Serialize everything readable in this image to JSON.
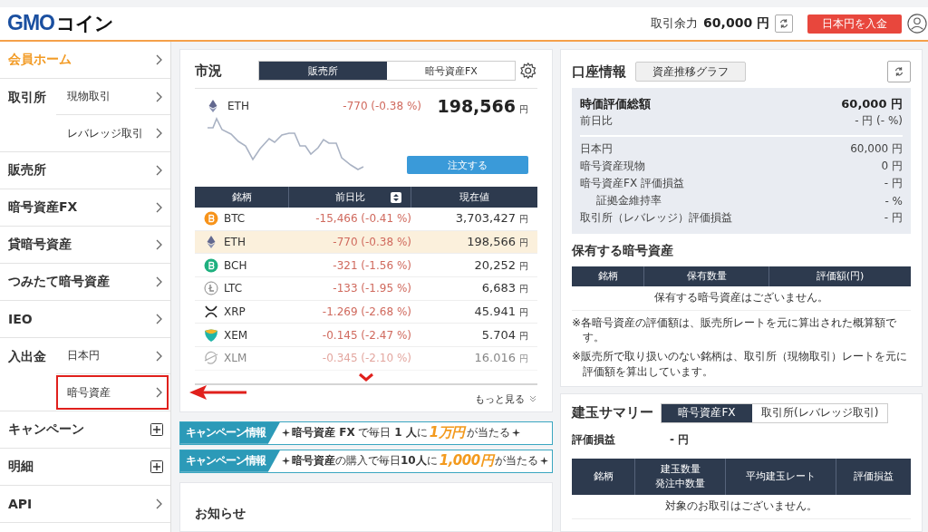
{
  "header": {
    "logo": {
      "brand": "GMO",
      "name": "コイン"
    },
    "balance_label": "取引余力",
    "balance_value": "60,000 円",
    "deposit_button": "日本円を入金"
  },
  "sidebar": {
    "items": [
      {
        "label": "会員ホーム",
        "kind": "link",
        "selected": true
      },
      {
        "label": "取引所",
        "kind": "group",
        "children": [
          {
            "label": "現物取引",
            "selected": false,
            "highlighted": false
          },
          {
            "label": "レバレッジ取引",
            "selected": false,
            "highlighted": false
          }
        ]
      },
      {
        "label": "販売所",
        "kind": "link",
        "selected": false
      },
      {
        "label": "暗号資産FX",
        "kind": "link",
        "selected": false
      },
      {
        "label": "貸暗号資産",
        "kind": "link",
        "selected": false
      },
      {
        "label": "つみたて暗号資産",
        "kind": "link",
        "selected": false
      },
      {
        "label": "IEO",
        "kind": "link",
        "selected": false
      },
      {
        "label": "入出金",
        "kind": "group",
        "children": [
          {
            "label": "日本円",
            "selected": false,
            "highlighted": false
          },
          {
            "label": "暗号資産",
            "selected": false,
            "highlighted": true
          }
        ]
      },
      {
        "label": "キャンペーン",
        "kind": "expand",
        "selected": false
      },
      {
        "label": "明細",
        "kind": "expand",
        "selected": false
      },
      {
        "label": "API",
        "kind": "link",
        "selected": false
      }
    ]
  },
  "market": {
    "title": "市況",
    "tabs": [
      {
        "label": "販売所",
        "selected": true
      },
      {
        "label": "暗号資産FX",
        "selected": false
      }
    ],
    "featured": {
      "kind": "eth",
      "symbol": "ETH",
      "change": "-770 (-0.38 %)",
      "price": "198,566",
      "unit": "円"
    },
    "order_button": "注文する",
    "columns": [
      "銘柄",
      "前日比",
      "現在値"
    ],
    "rows": [
      {
        "kind": "btc",
        "symbol": "BTC",
        "change": "-15,466 (-0.41 %)",
        "price": "3,703,427",
        "unit": "円",
        "selected": false
      },
      {
        "kind": "eth",
        "symbol": "ETH",
        "change": "-770 (-0.38 %)",
        "price": "198,566",
        "unit": "円",
        "selected": true
      },
      {
        "kind": "bch",
        "symbol": "BCH",
        "change": "-321 (-1.56 %)",
        "price": "20,252",
        "unit": "円",
        "selected": false
      },
      {
        "kind": "ltc",
        "symbol": "LTC",
        "change": "-133 (-1.95 %)",
        "price": "6,683",
        "unit": "円",
        "selected": false
      },
      {
        "kind": "xrp",
        "symbol": "XRP",
        "change": "-1.269 (-2.68 %)",
        "price": "45.941",
        "unit": "円",
        "selected": false
      },
      {
        "kind": "xem",
        "symbol": "XEM",
        "change": "-0.145 (-2.47 %)",
        "price": "5.704",
        "unit": "円",
        "selected": false
      },
      {
        "kind": "xlm",
        "symbol": "XLM",
        "change": "-0.345 (-2.10 %)",
        "price": "16.016",
        "unit": "円",
        "selected": false,
        "faded": true
      }
    ],
    "more_link": "もっと見る"
  },
  "banners": [
    {
      "tag": "キャンペーン情報",
      "text": "**暗号資産 FX** で毎日 **1 人**に",
      "prize": "1万円",
      "suffix": "が当たる"
    },
    {
      "tag": "キャンペーン情報",
      "text": "**暗号資産**の購入で毎日**10人**に",
      "prize": "1,000円",
      "suffix": "が当たる"
    }
  ],
  "news": {
    "title": "お知らせ"
  },
  "account": {
    "title": "口座情報",
    "graph_button": "資産推移グラフ",
    "summary_groups": [
      {
        "rows": [
          {
            "label": "時価評価総額",
            "value": "60,000 円",
            "kind": "total"
          },
          {
            "label": "前日比",
            "value": "- 円 (- %)",
            "kind": "plain"
          }
        ]
      },
      {
        "rows": [
          {
            "label": "日本円",
            "value": "60,000 円",
            "kind": "plain"
          },
          {
            "label": "暗号資産現物",
            "value": "0 円",
            "kind": "plain"
          },
          {
            "label": "暗号資産FX 評価損益",
            "value": "- 円",
            "kind": "plain"
          },
          {
            "label": "証拠金維持率",
            "value": "- %",
            "kind": "indent"
          },
          {
            "label": "取引所（レバレッジ）評価損益",
            "value": "- 円",
            "kind": "plain"
          }
        ]
      }
    ],
    "holdings_title": "保有する暗号資産",
    "holdings_columns": [
      "銘柄",
      "保有数量",
      "評価額(円)"
    ],
    "holdings_empty": "保有する暗号資産はございません。",
    "notes": [
      "※各暗号資産の評価額は、販売所レートを元に算出された概算額です。",
      "※販売所で取り扱いのない銘柄は、取引所（現物取引）レートを元に評価額を算出しています。"
    ]
  },
  "positions": {
    "title": "建玉サマリー",
    "tabs": [
      {
        "label": "暗号資産FX",
        "selected": true
      },
      {
        "label": "取引所(レバレッジ取引)",
        "selected": false
      }
    ],
    "pl_label": "評価損益",
    "pl_value": "- 円",
    "columns": [
      [
        "銘柄"
      ],
      [
        "建玉数量",
        "発注中数量"
      ],
      [
        "平均建玉レート"
      ],
      [
        "評価損益"
      ]
    ],
    "empty": "対象のお取引はございません。"
  }
}
